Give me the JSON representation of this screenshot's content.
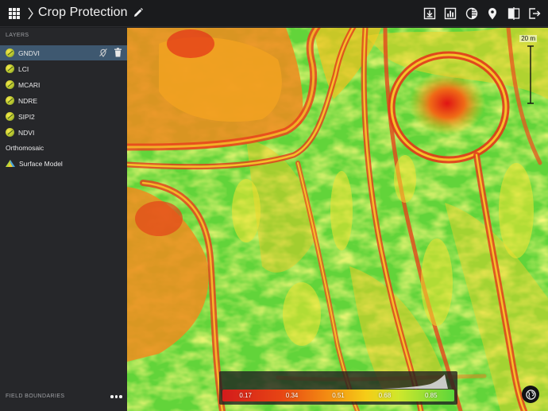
{
  "header": {
    "title": "Crop Protection",
    "tools": [
      "download-icon",
      "bar-chart-icon",
      "contrast-icon",
      "map-pin-icon",
      "compare-icon",
      "logout-icon"
    ]
  },
  "sidebar": {
    "layers_heading": "LAYERS",
    "layers": [
      {
        "label": "GNDVI",
        "active": true
      },
      {
        "label": "LCI",
        "active": false
      },
      {
        "label": "MCARI",
        "active": false
      },
      {
        "label": "NDRE",
        "active": false
      },
      {
        "label": "SIPI2",
        "active": false
      },
      {
        "label": "NDVI",
        "active": false
      }
    ],
    "orthomosaic_label": "Orthomosaic",
    "surface_model_label": "Surface Model",
    "field_boundaries_heading": "FIELD BOUNDARIES"
  },
  "map": {
    "scale_label": "20 m",
    "legend_ticks": [
      "0.17",
      "0.34",
      "0.51",
      "0.68",
      "0.85"
    ]
  },
  "colors": {
    "active_row": "#3e5870",
    "low": "#d31b1b",
    "mid": "#f5cd17",
    "high": "#5ad63a"
  }
}
